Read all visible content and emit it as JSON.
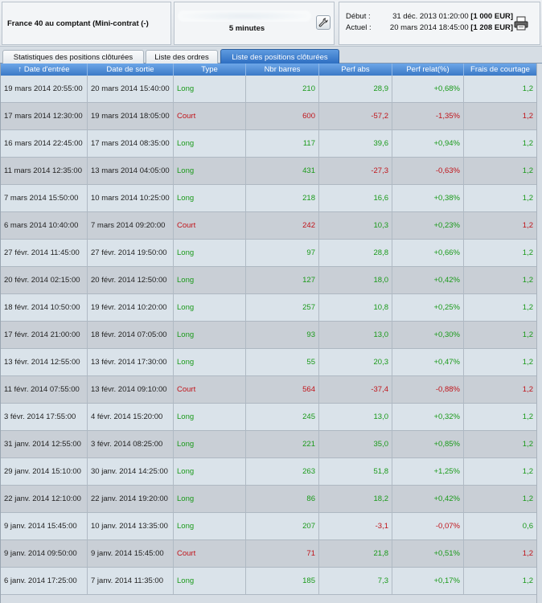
{
  "header": {
    "instrument": "France 40 au comptant (Mini-contrat  (-)",
    "timeframe": "5 minutes",
    "start_label": "Début :",
    "start_date": "31 déc. 2013 01:20:00",
    "start_capital": "[1 000 EUR]",
    "current_label": "Actuel :",
    "current_date": "20 mars 2014 18:45:00",
    "current_capital": "[1 208 EUR]"
  },
  "icons": {
    "settings": "wrench-icon",
    "print": "printer-icon",
    "sort": "sort-up-arrow-icon"
  },
  "colors": {
    "positive": "#1a9a1a",
    "negative": "#c0141a",
    "active_tab": "#3b79c6"
  },
  "tabs": [
    {
      "label": "Statistiques des positions clôturées"
    },
    {
      "label": "Liste des ordres"
    },
    {
      "label": "Liste des positions clôturées"
    }
  ],
  "table": {
    "sort_arrow": "↑",
    "columns": [
      "Date d'entrée",
      "Date de sortie",
      "Type",
      "Nbr barres",
      "Perf abs",
      "Perf relat(%)",
      "Frais de courtage"
    ],
    "rows": [
      [
        "19 mars 2014 20:55:00",
        "20 mars 2014 15:40:00",
        "Long",
        "210",
        "28,9",
        "+0,68%",
        "1,2"
      ],
      [
        "17 mars 2014 12:30:00",
        "19 mars 2014 18:05:00",
        "Court",
        "600",
        "-57,2",
        "-1,35%",
        "1,2"
      ],
      [
        "16 mars 2014 22:45:00",
        "17 mars 2014 08:35:00",
        "Long",
        "117",
        "39,6",
        "+0,94%",
        "1,2"
      ],
      [
        "11 mars 2014 12:35:00",
        "13 mars 2014 04:05:00",
        "Long",
        "431",
        "-27,3",
        "-0,63%",
        "1,2"
      ],
      [
        "7 mars 2014 15:50:00",
        "10 mars 2014 10:25:00",
        "Long",
        "218",
        "16,6",
        "+0,38%",
        "1,2"
      ],
      [
        "6 mars 2014 10:40:00",
        "7 mars 2014 09:20:00",
        "Court",
        "242",
        "10,3",
        "+0,23%",
        "1,2"
      ],
      [
        "27 févr. 2014 11:45:00",
        "27 févr. 2014 19:50:00",
        "Long",
        "97",
        "28,8",
        "+0,66%",
        "1,2"
      ],
      [
        "20 févr. 2014 02:15:00",
        "20 févr. 2014 12:50:00",
        "Long",
        "127",
        "18,0",
        "+0,42%",
        "1,2"
      ],
      [
        "18 févr. 2014 10:50:00",
        "19 févr. 2014 10:20:00",
        "Long",
        "257",
        "10,8",
        "+0,25%",
        "1,2"
      ],
      [
        "17 févr. 2014 21:00:00",
        "18 févr. 2014 07:05:00",
        "Long",
        "93",
        "13,0",
        "+0,30%",
        "1,2"
      ],
      [
        "13 févr. 2014 12:55:00",
        "13 févr. 2014 17:30:00",
        "Long",
        "55",
        "20,3",
        "+0,47%",
        "1,2"
      ],
      [
        "11 févr. 2014 07:55:00",
        "13 févr. 2014 09:10:00",
        "Court",
        "564",
        "-37,4",
        "-0,88%",
        "1,2"
      ],
      [
        "3 févr. 2014 17:55:00",
        "4 févr. 2014 15:20:00",
        "Long",
        "245",
        "13,0",
        "+0,32%",
        "1,2"
      ],
      [
        "31 janv. 2014 12:55:00",
        "3 févr. 2014 08:25:00",
        "Long",
        "221",
        "35,0",
        "+0,85%",
        "1,2"
      ],
      [
        "29 janv. 2014 15:10:00",
        "30 janv. 2014 14:25:00",
        "Long",
        "263",
        "51,8",
        "+1,25%",
        "1,2"
      ],
      [
        "22 janv. 2014 12:10:00",
        "22 janv. 2014 19:20:00",
        "Long",
        "86",
        "18,2",
        "+0,42%",
        "1,2"
      ],
      [
        "9 janv. 2014 15:45:00",
        "10 janv. 2014 13:35:00",
        "Long",
        "207",
        "-3,1",
        "-0,07%",
        "0,6"
      ],
      [
        "9 janv. 2014 09:50:00",
        "9 janv. 2014 15:45:00",
        "Court",
        "71",
        "21,8",
        "+0,51%",
        "1,2"
      ],
      [
        "6 janv. 2014 17:25:00",
        "7 janv. 2014 11:35:00",
        "Long",
        "185",
        "7,3",
        "+0,17%",
        "1,2"
      ]
    ]
  }
}
